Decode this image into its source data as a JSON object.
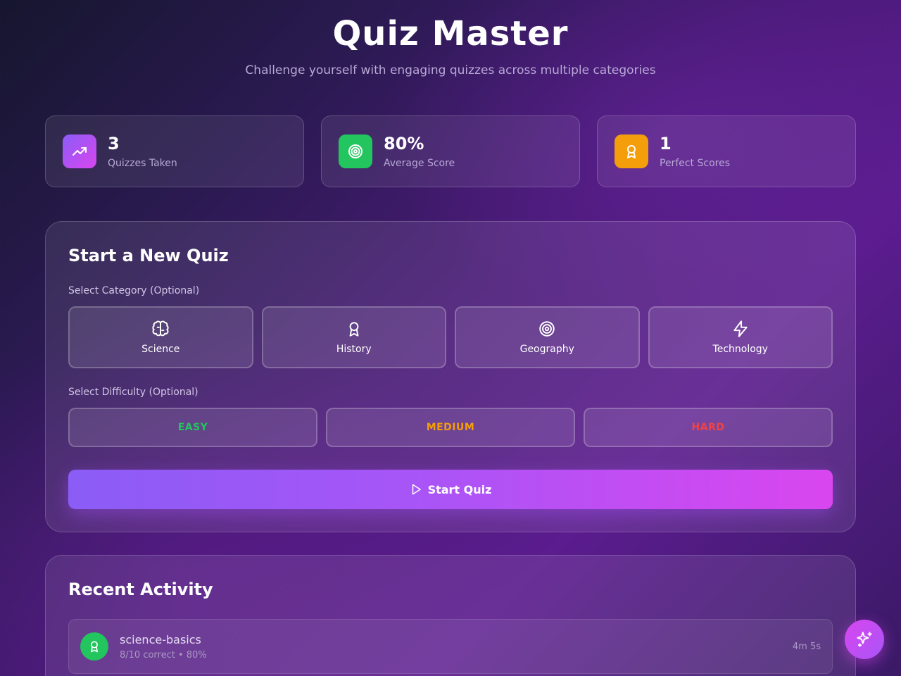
{
  "header": {
    "title": "Quiz Master",
    "subtitle": "Challenge yourself with engaging quizzes across multiple categories"
  },
  "stats": [
    {
      "value": "3",
      "label": "Quizzes Taken",
      "icon": "trending-up-icon",
      "color": "#a855f7"
    },
    {
      "value": "80%",
      "label": "Average Score",
      "icon": "target-icon",
      "color": "#22c55e"
    },
    {
      "value": "1",
      "label": "Perfect Scores",
      "icon": "award-icon",
      "color": "#f59e0b"
    }
  ],
  "new_quiz": {
    "title": "Start a New Quiz",
    "category_label": "Select Category (Optional)",
    "categories": [
      {
        "label": "Science",
        "icon": "brain-icon"
      },
      {
        "label": "History",
        "icon": "award-icon"
      },
      {
        "label": "Geography",
        "icon": "target-icon"
      },
      {
        "label": "Technology",
        "icon": "zap-icon"
      }
    ],
    "difficulty_label": "Select Difficulty (Optional)",
    "difficulties": [
      {
        "label": "EASY",
        "color": "#22c55e"
      },
      {
        "label": "MEDIUM",
        "color": "#f59e0b"
      },
      {
        "label": "HARD",
        "color": "#ef4444"
      }
    ],
    "start_label": "Start Quiz"
  },
  "recent": {
    "title": "Recent Activity",
    "items": [
      {
        "name": "science-basics",
        "detail": "8/10 correct • 80%",
        "time": "4m 5s",
        "icon": "award-icon"
      }
    ]
  },
  "fab": {
    "icon": "sparkles-icon"
  }
}
